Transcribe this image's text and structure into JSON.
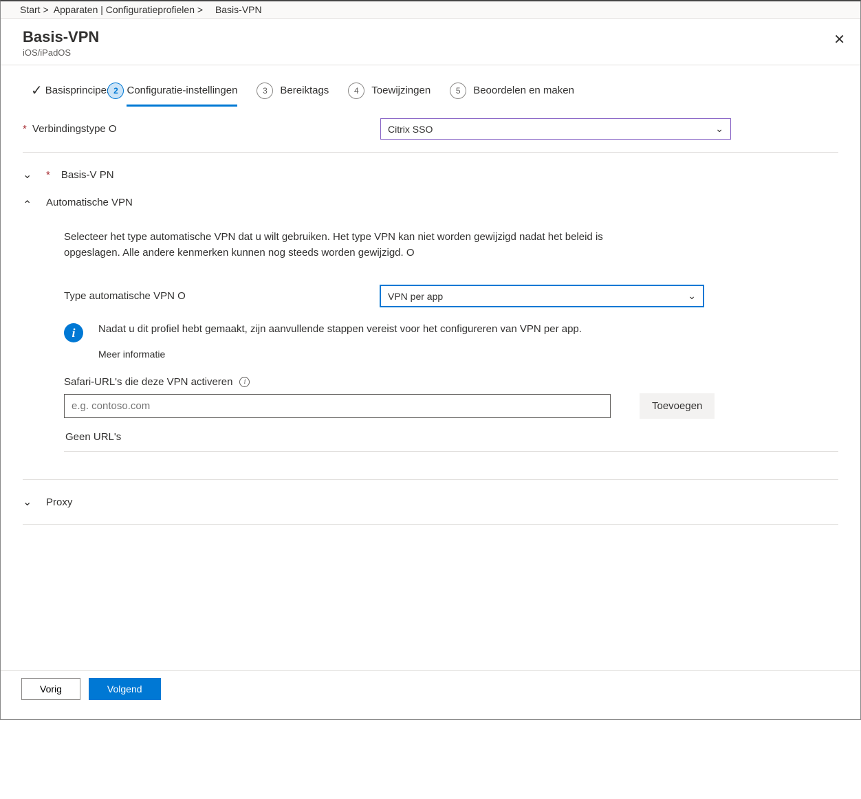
{
  "breadcrumb": {
    "home": "Start >",
    "devices": "Apparaten | Configuratieprofielen >",
    "current": "Basis-VPN"
  },
  "header": {
    "title": "Basis-VPN",
    "subtitle": "iOS/iPadOS",
    "close_glyph": "✕"
  },
  "wizard": {
    "step1": "Basisprincipes",
    "step2": "Configuratie-instellingen",
    "step2_num": "2",
    "step3_num": "3",
    "step3": "Bereiktags",
    "step4_num": "4",
    "step4": "Toewijzingen",
    "step5_num": "5",
    "step5": "Beoordelen en maken"
  },
  "form": {
    "connection_type_label": "Verbindingstype O",
    "connection_type_value": "Citrix SSO"
  },
  "sections": {
    "base_vpn": "Basis-V PN",
    "auto_vpn": "Automatische VPN",
    "proxy": "Proxy"
  },
  "auto": {
    "description": "Selecteer het type automatische VPN dat u wilt gebruiken. Het type VPN kan niet worden gewijzigd nadat het beleid is opgeslagen. Alle andere kenmerken kunnen nog steeds worden gewijzigd. O",
    "type_label": "Type automatische VPN O",
    "type_value": "VPN per app",
    "info_text": "Nadat u dit profiel hebt gemaakt, zijn aanvullende stappen vereist voor het configureren van VPN per app.",
    "info_link": "Meer informatie",
    "safari_label": "Safari-URL's die deze VPN activeren",
    "safari_placeholder": "e.g. contoso.com",
    "add_btn": "Toevoegen",
    "no_urls": "Geen URL's"
  },
  "footer": {
    "prev": "Vorig",
    "next": "Volgend"
  },
  "glyphs": {
    "check": "✓",
    "chev_down_sm": "⌄",
    "chev_down_big": "⌄",
    "chev_up": "⌃",
    "info": "i"
  }
}
